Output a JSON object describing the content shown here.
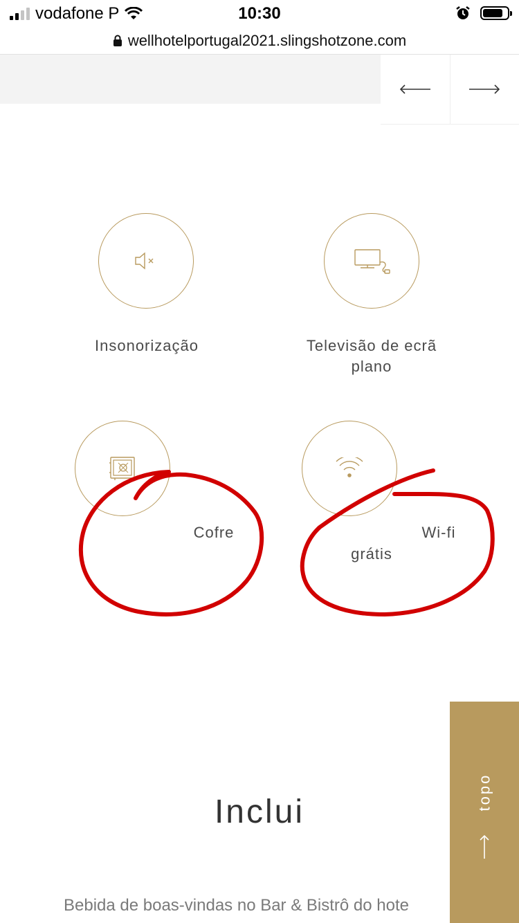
{
  "status_bar": {
    "carrier": "vodafone P",
    "time": "10:30"
  },
  "browser": {
    "url": "wellhotelportugal2021.slingshotzone.com"
  },
  "amenities": [
    {
      "label": "Insonorização",
      "icon": "muted-speaker-icon"
    },
    {
      "label": "Televisão de ecrã plano",
      "icon": "tv-icon"
    },
    {
      "label": "Cofre",
      "icon": "safe-icon"
    },
    {
      "label_line1": "Wi-fi",
      "label_line2": "grátis",
      "icon": "wifi-icon"
    }
  ],
  "section": {
    "title": "Inclui",
    "first_item": "Bebida de boas-vindas no Bar & Bistrô do hote"
  },
  "topo_button": {
    "label": "topo"
  },
  "colors": {
    "accent": "#b89a5e",
    "annotation": "#d10000",
    "gray_band": "#f3f3f3"
  }
}
